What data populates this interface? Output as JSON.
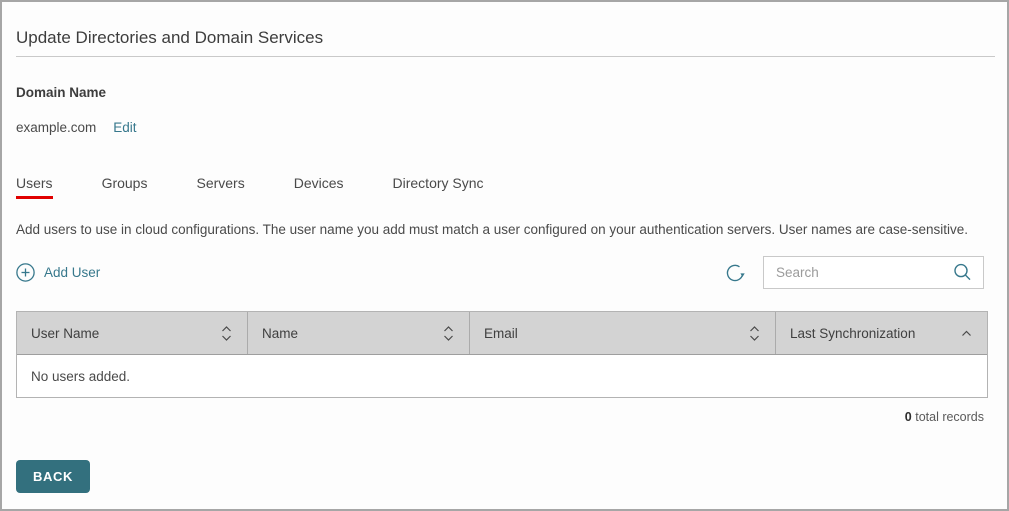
{
  "page": {
    "title": "Update Directories and Domain Services"
  },
  "domain": {
    "label": "Domain Name",
    "value": "example.com",
    "edit_label": "Edit"
  },
  "tabs": [
    {
      "label": "Users",
      "active": true
    },
    {
      "label": "Groups",
      "active": false
    },
    {
      "label": "Servers",
      "active": false
    },
    {
      "label": "Devices",
      "active": false
    },
    {
      "label": "Directory Sync",
      "active": false
    }
  ],
  "description": "Add users to use in cloud configurations. The user name you add must match a user configured on your authentication servers. User names are case-sensitive.",
  "toolbar": {
    "add_user_label": "Add User",
    "add_user_icon": "plus-circle-icon",
    "refresh_icon": "refresh-icon",
    "search": {
      "placeholder": "Search",
      "value": "",
      "icon": "search-icon"
    }
  },
  "table": {
    "columns": [
      {
        "label": "User Name",
        "sort": "sortable"
      },
      {
        "label": "Name",
        "sort": "sortable"
      },
      {
        "label": "Email",
        "sort": "sortable"
      },
      {
        "label": "Last Synchronization",
        "sort": "asc"
      }
    ],
    "rows": [],
    "empty_message": "No users added."
  },
  "footer": {
    "total_count": "0",
    "total_label": "total records"
  },
  "actions": {
    "back_label": "BACK"
  },
  "colors": {
    "accent_teal": "#37788c",
    "button_teal": "#33707e",
    "active_tab_underline": "#e00000",
    "table_header_bg": "#d3d3d3",
    "page_border": "#a6a6a6"
  }
}
